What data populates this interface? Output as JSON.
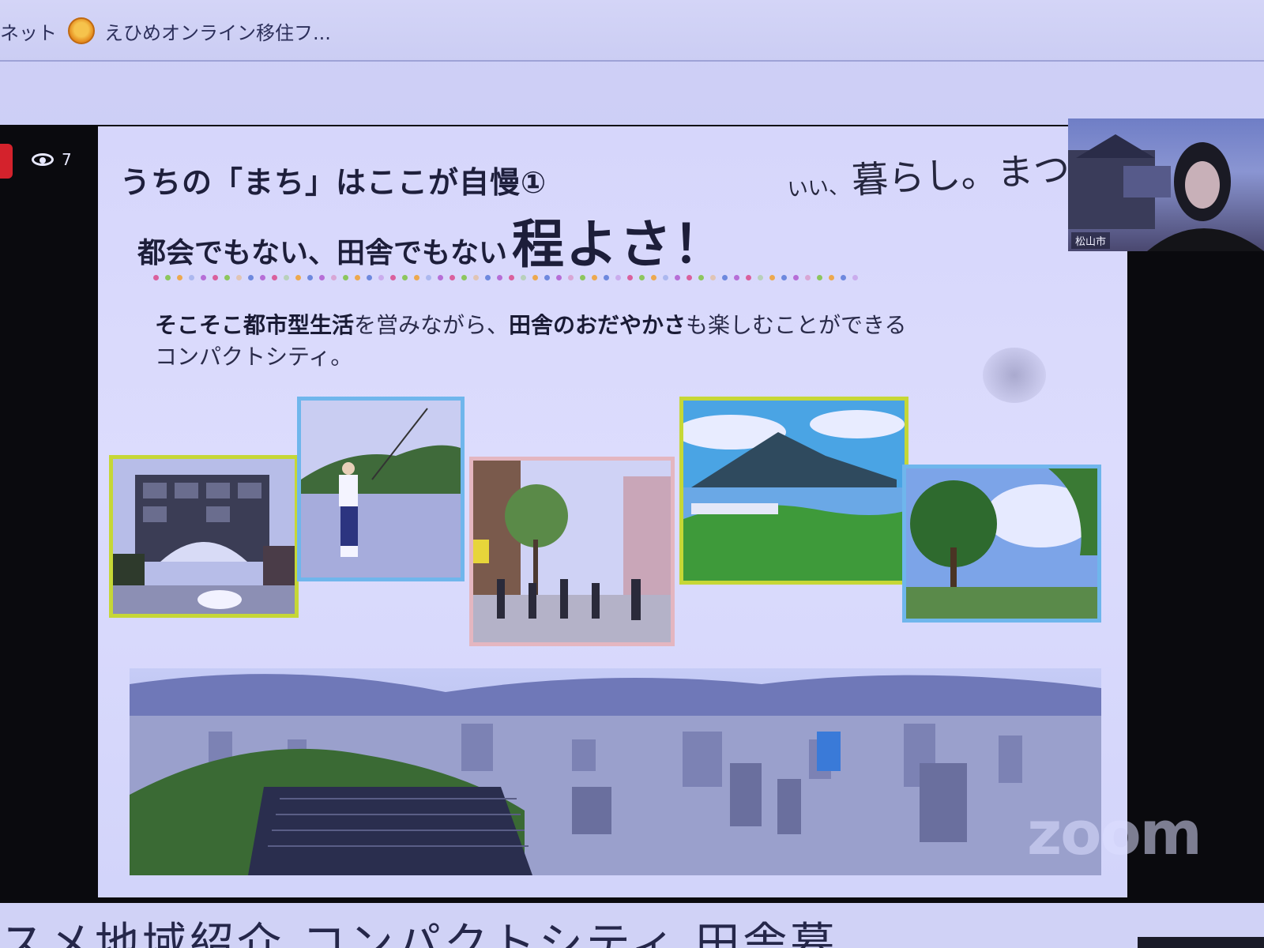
{
  "browser": {
    "bookmarks": [
      {
        "label": "ネット"
      },
      {
        "label": "えひめオンライン移住フ..."
      }
    ]
  },
  "zoom": {
    "viewer_count": "7",
    "watermark": "zoom",
    "webcam_label": "松山市"
  },
  "slide": {
    "title": "うちの「まち」はここが自慢①",
    "subtitle_prefix": "都会でもない、田舎でもない",
    "subtitle_emphasis": "程よさ！",
    "brand_small": "いい、",
    "brand_big": "暮らし。まつや",
    "body_line1_bold1": "そこそこ都市型生活",
    "body_line1_text1": "を営みながら、",
    "body_line1_bold2": "田舎のおだやかさ",
    "body_line1_text2": "も楽しむことができる",
    "body_line2": "コンパクトシティ。",
    "dot_colors": [
      "#d94a8c",
      "#7fc242",
      "#f0a030",
      "#5a7ad8",
      "#b05ad0"
    ]
  },
  "bottom": {
    "text": "スメ地域紹介 コンパクトシティ 田舎暮"
  }
}
